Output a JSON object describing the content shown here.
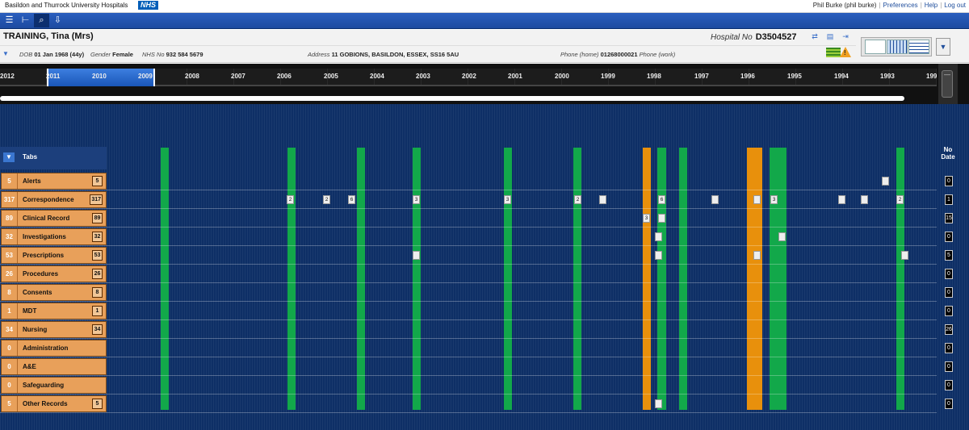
{
  "org": {
    "name": "Basildon and Thurrock University Hospitals",
    "logo": "NHS"
  },
  "user": {
    "name": "Phil Burke (phil burke)",
    "links": [
      "Preferences",
      "Help",
      "Log out"
    ]
  },
  "toolbar": {
    "icons": [
      "list-icon",
      "bed-icon",
      "search-icon",
      "inbox-icon"
    ]
  },
  "patient": {
    "name": "TRAINING, Tina (Mrs)",
    "hospital_no_label": "Hospital No",
    "hospital_no": "D3504527",
    "dob_label": "DOB",
    "dob": "01 Jan 1968 (44y)",
    "gender_label": "Gender",
    "gender": "Female",
    "nhs_label": "NHS No",
    "nhs": "932 584 5679",
    "address_label": "Address",
    "address": "11 GOBIONS, BASILDON, ESSEX, SS16 5AU",
    "phone_home_label": "Phone (home)",
    "phone_home": "01268000021",
    "phone_work_label": "Phone (work)"
  },
  "timeline": {
    "years": [
      "2012",
      "2011",
      "2010",
      "2009",
      "2008",
      "2007",
      "2006",
      "2005",
      "2004",
      "2003",
      "2002",
      "2001",
      "2000",
      "1999",
      "1998",
      "1997",
      "1996",
      "1995",
      "1994",
      "1993",
      "199"
    ],
    "tabs_label": "Tabs",
    "nodate_label": "No Date"
  },
  "categories": [
    {
      "name": "Alerts",
      "count": "5",
      "box": "5",
      "nodate": "0"
    },
    {
      "name": "Correspondence",
      "count": "317",
      "box": "317",
      "nodate": "1"
    },
    {
      "name": "Clinical Record",
      "count": "89",
      "box": "89",
      "nodate": "15"
    },
    {
      "name": "Investigations",
      "count": "32",
      "box": "32",
      "nodate": "0"
    },
    {
      "name": "Prescriptions",
      "count": "53",
      "box": "53",
      "nodate": "5"
    },
    {
      "name": "Procedures",
      "count": "26",
      "box": "26",
      "nodate": "0"
    },
    {
      "name": "Consents",
      "count": "8",
      "box": "8",
      "nodate": "0"
    },
    {
      "name": "MDT",
      "count": "1",
      "box": "1",
      "nodate": "0"
    },
    {
      "name": "Nursing",
      "count": "34",
      "box": "34",
      "nodate": "26"
    },
    {
      "name": "Administration",
      "count": "0",
      "box": "",
      "nodate": "0"
    },
    {
      "name": "A&E",
      "count": "0",
      "box": "",
      "nodate": "0"
    },
    {
      "name": "Safeguarding",
      "count": "0",
      "box": "",
      "nodate": "0"
    },
    {
      "name": "Other Records",
      "count": "5",
      "box": "5",
      "nodate": "0"
    }
  ],
  "markers": [
    {
      "row": 0,
      "label": ""
    },
    {
      "row": 1,
      "label": "2"
    },
    {
      "row": 1,
      "label": "2"
    },
    {
      "row": 1,
      "label": "6"
    },
    {
      "row": 1,
      "label": "3"
    },
    {
      "row": 1,
      "label": "3"
    },
    {
      "row": 1,
      "label": "2"
    },
    {
      "row": 1,
      "label": ""
    },
    {
      "row": 1,
      "label": "6"
    },
    {
      "row": 1,
      "label": ""
    },
    {
      "row": 1,
      "label": ""
    },
    {
      "row": 1,
      "label": "3"
    },
    {
      "row": 1,
      "label": ""
    },
    {
      "row": 1,
      "label": ""
    },
    {
      "row": 1,
      "label": "2"
    },
    {
      "row": 2,
      "label": "3"
    },
    {
      "row": 2,
      "label": ""
    },
    {
      "row": 3,
      "label": ""
    },
    {
      "row": 3,
      "label": ""
    },
    {
      "row": 4,
      "label": ""
    },
    {
      "row": 4,
      "label": ""
    },
    {
      "row": 4,
      "label": ""
    },
    {
      "row": 4,
      "label": ""
    },
    {
      "row": 12,
      "label": ""
    }
  ],
  "colors": {
    "encounter_green": "#12a84a",
    "encounter_orange": "#e8900c",
    "category_bg": "#e8a05a",
    "timeline_bg": "#0e2f66"
  }
}
